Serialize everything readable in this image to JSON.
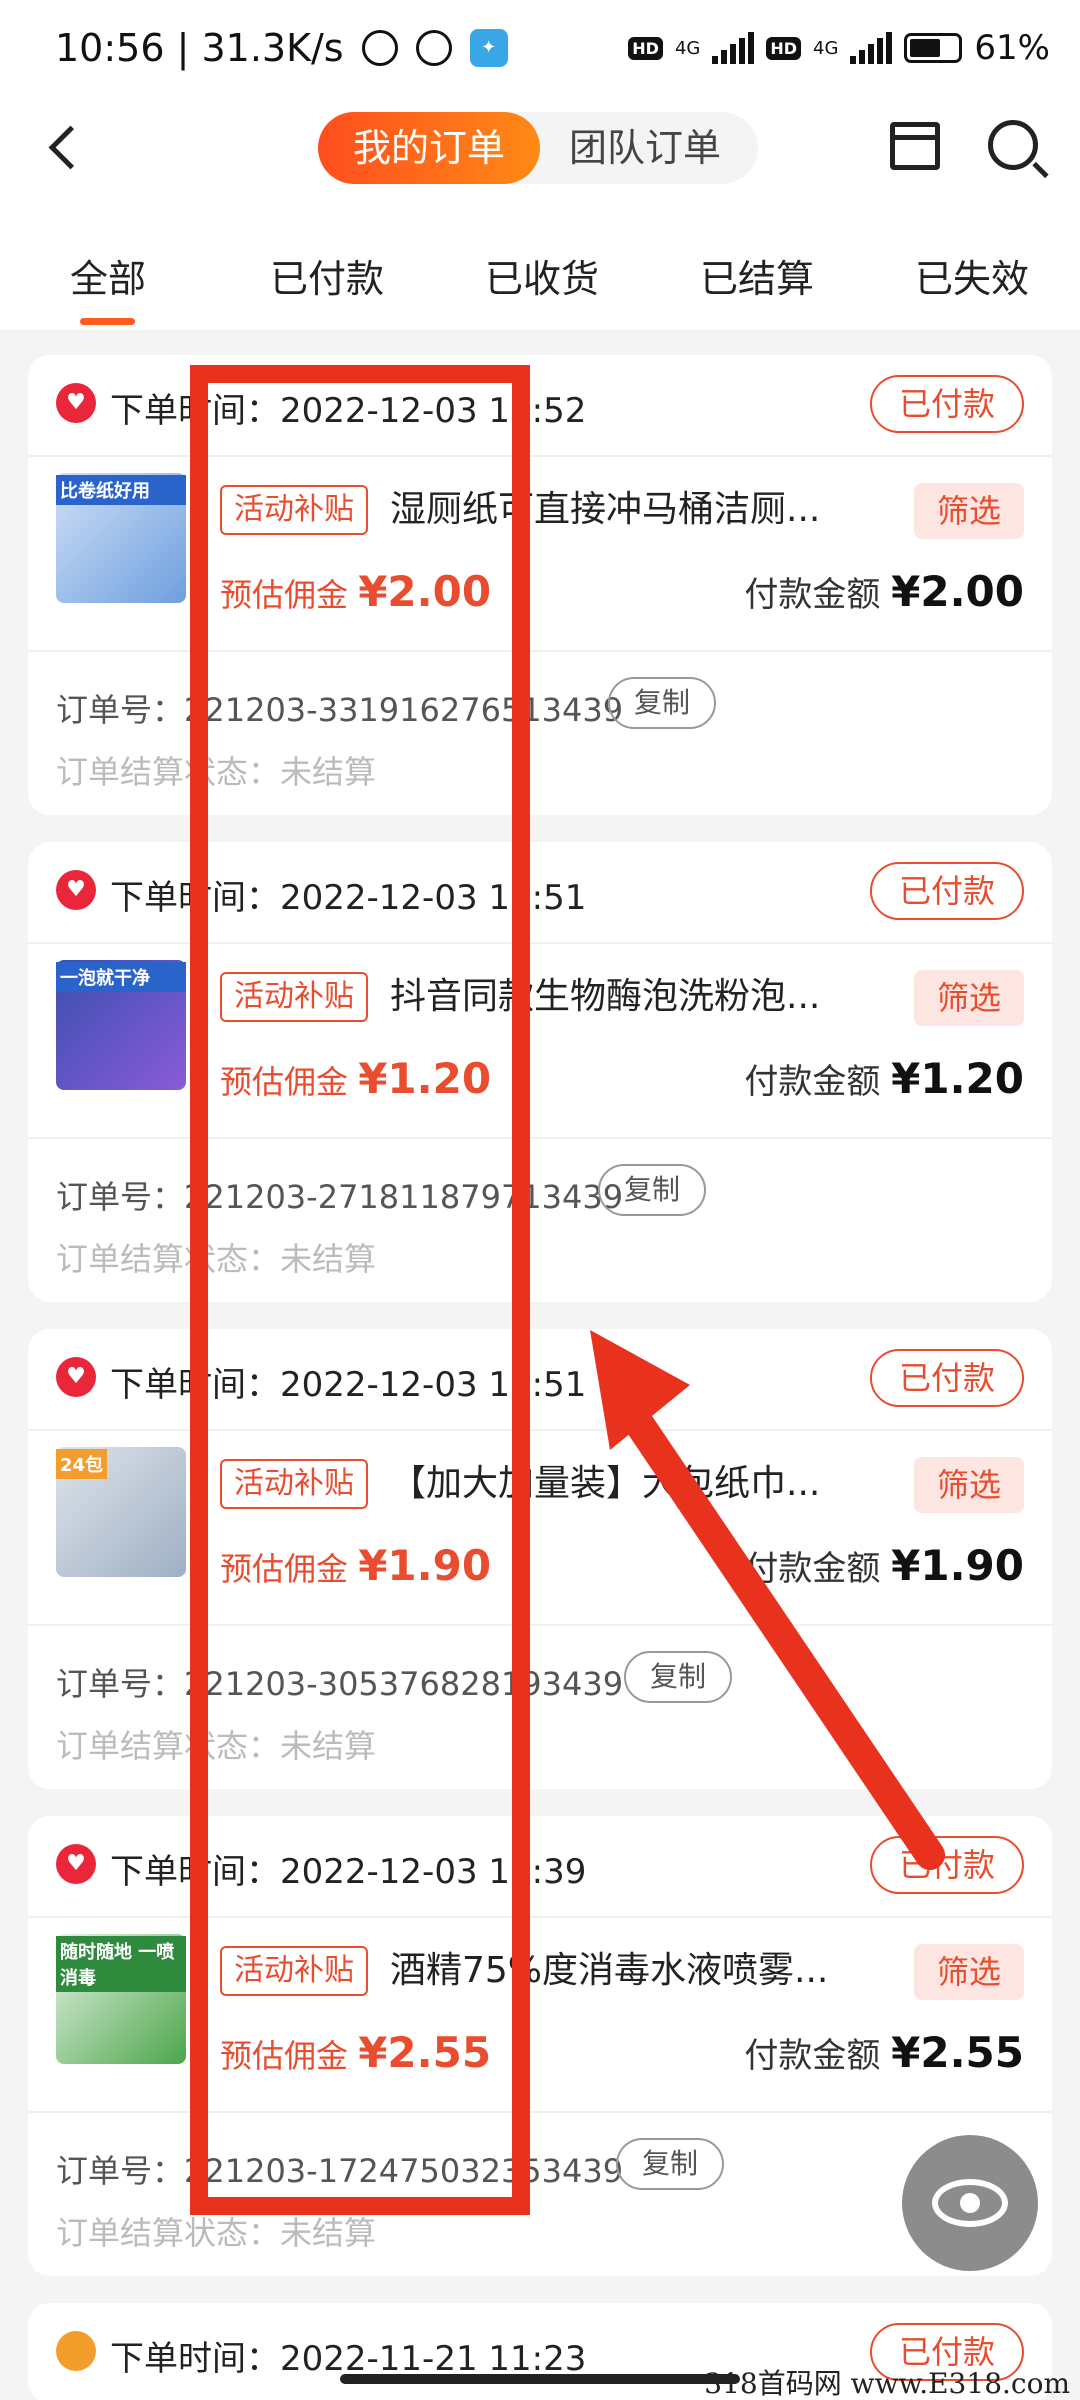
{
  "status_bar": {
    "time_speed": "10:56 | 31.3K/s",
    "network1": "4G",
    "network2": "4G",
    "hd": "HD",
    "battery": "61%"
  },
  "header": {
    "seg_active": "我的订单",
    "seg_other": "团队订单"
  },
  "tabs": [
    "全部",
    "已付款",
    "已收货",
    "已结算",
    "已失效"
  ],
  "labels": {
    "promo": "活动补贴",
    "filter": "筛选",
    "commission_label": "预估佣金",
    "pay_label": "付款金额",
    "copy": "复制",
    "status": "已付款"
  },
  "orders": [
    {
      "time": "下单时间：2022-12-03 10:52",
      "title": "湿厕纸可直接冲马桶洁厕...",
      "commission": "¥2.00",
      "pay": "¥2.00",
      "order_no": "订单号：221203-331916276513439",
      "settle": "订单结算状态：未结算",
      "thumb_text": "比卷纸好用"
    },
    {
      "time": "下单时间：2022-12-03 10:51",
      "title": "抖音同款生物酶泡洗粉泡...",
      "commission": "¥1.20",
      "pay": "¥1.20",
      "order_no": "订单号：221203-271811879713439",
      "settle": "订单结算状态：未结算",
      "thumb_text": "一泡就干净"
    },
    {
      "time": "下单时间：2022-12-03 10:51",
      "title": "【加大加量装】大包纸巾...",
      "commission": "¥1.90",
      "pay": "¥1.90",
      "order_no": "订单号：221203-305376828193439",
      "settle": "订单结算状态：未结算",
      "thumb_text": "24包"
    },
    {
      "time": "下单时间：2022-12-03 10:39",
      "title": "酒精75%度消毒水液喷雾...",
      "commission": "¥2.55",
      "pay": "¥2.55",
      "order_no": "订单号：221203-172475032353439",
      "settle": "订单结算状态：未结算",
      "thumb_text": "随时随地 一喷消毒"
    }
  ],
  "partial_order": {
    "time": "下单时间：2022-11-21 11:23",
    "status": "已付款"
  },
  "watermark": "318首码网 www.E318.com",
  "colors": {
    "accent": "#e84d2f",
    "annotation": "#e8321e"
  }
}
